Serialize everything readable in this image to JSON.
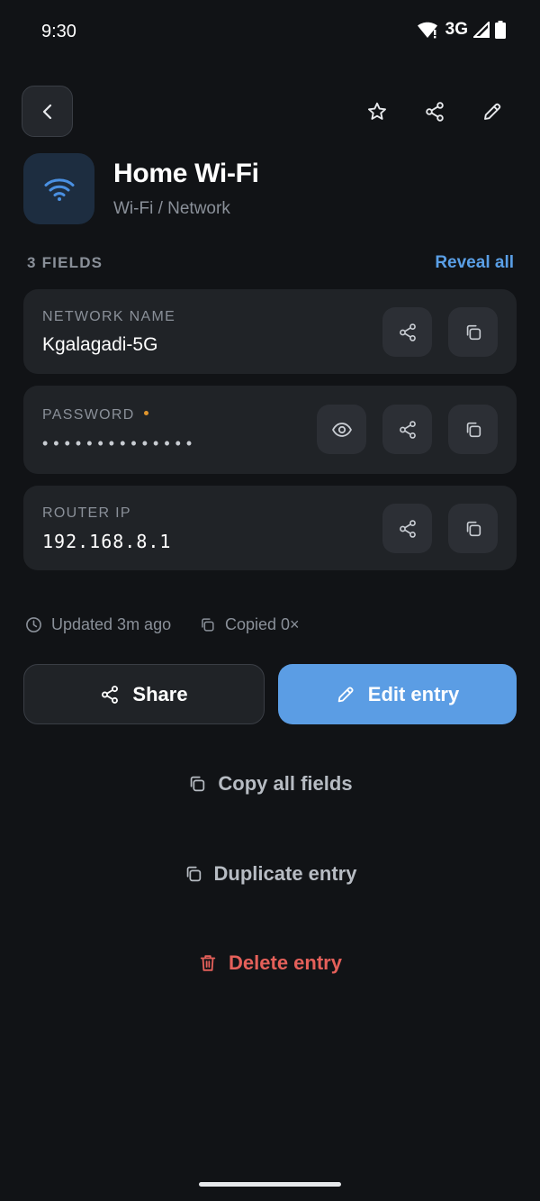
{
  "status_bar": {
    "time": "9:30",
    "network": "3G",
    "icons": [
      "wifi-icon",
      "signal-icon",
      "battery-icon"
    ]
  },
  "top_bar": {
    "back_icon": "chevron-left-icon",
    "actions": [
      "star-icon",
      "share-icon",
      "pencil-icon"
    ]
  },
  "entry": {
    "icon": "wifi-icon",
    "title": "Home Wi-Fi",
    "category": "Wi-Fi / Network"
  },
  "fields_header": {
    "count_label": "3 FIELDS",
    "reveal_all": "Reveal all"
  },
  "fields": [
    {
      "label": "NETWORK NAME",
      "value": "Kgalagadi-5G",
      "actions": [
        "share-icon",
        "copy-icon"
      ]
    },
    {
      "label": "PASSWORD",
      "required": true,
      "value": "••••••••••••••",
      "masked": true,
      "actions": [
        "eye-icon",
        "share-icon",
        "copy-icon"
      ]
    },
    {
      "label": "ROUTER IP",
      "value": "192.168.8.1",
      "actions": [
        "share-icon",
        "copy-icon"
      ]
    }
  ],
  "meta": {
    "updated": "Updated 3m ago",
    "copied": "Copied 0×"
  },
  "buttons": {
    "share": "Share",
    "edit": "Edit entry",
    "copy_all": "Copy all fields",
    "duplicate": "Duplicate entry",
    "delete": "Delete entry"
  },
  "colors": {
    "background": "#111316",
    "card": "#202327",
    "accent": "#5b9de4",
    "link": "#5a9fe6",
    "danger": "#e5605a",
    "required_dot": "#e0952d",
    "muted_text": "#8a9099"
  }
}
